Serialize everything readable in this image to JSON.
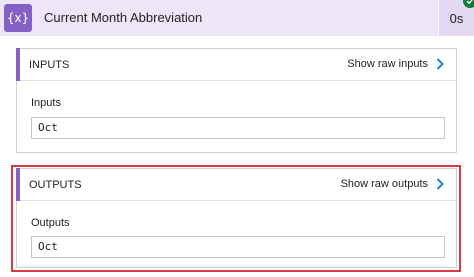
{
  "action": {
    "title": "Current Month Abbreviation",
    "duration": "0s",
    "icon": "expression-braces-icon",
    "status_icon": "success-check-icon",
    "accent_color": "#8661c5"
  },
  "inputs_card": {
    "title": "INPUTS",
    "raw_link": "Show raw inputs",
    "field_label": "Inputs",
    "field_value": "Oct"
  },
  "outputs_card": {
    "title": "OUTPUTS",
    "raw_link": "Show raw outputs",
    "field_label": "Outputs",
    "field_value": "Oct"
  },
  "colors": {
    "header_bg": "#ede6f6",
    "link_chevron": "#0078d4",
    "highlight_border": "#d83b43"
  }
}
